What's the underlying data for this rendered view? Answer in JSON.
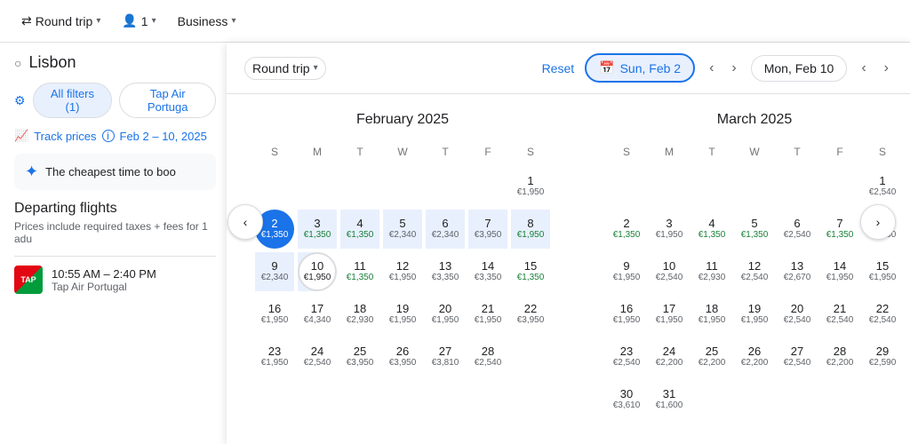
{
  "topbar": {
    "trip_type": "Round trip",
    "passengers": "1",
    "cabin_class": "Business"
  },
  "left_panel": {
    "search_placeholder": "Lisbon",
    "filters_btn": "All filters (1)",
    "airline_filter": "Tap Air Portuga",
    "track_prices_label": "Track prices",
    "track_prices_date": "Feb 2 – 10, 2025",
    "cheapest_time": "The cheapest time to boo",
    "departing_title": "Departing flights",
    "departing_sub": "Prices include required taxes + fees for 1 adu",
    "flight_time": "10:55 AM – 2:40 PM",
    "flight_airline": "Tap Air Portugal"
  },
  "calendar": {
    "trip_type": "Round trip",
    "reset_label": "Reset",
    "selected_start": "Sun, Feb 2",
    "selected_end": "Mon, Feb 10",
    "february": {
      "title": "February 2025",
      "weekdays": [
        "S",
        "M",
        "T",
        "W",
        "T",
        "F",
        "S"
      ],
      "weeks": [
        [
          null,
          null,
          null,
          null,
          null,
          null,
          {
            "d": 1,
            "p": "€1,950",
            "g": false
          }
        ],
        [
          {
            "d": 2,
            "p": "€1,350",
            "g": true,
            "selected": true
          },
          {
            "d": 3,
            "p": "€1,350",
            "g": true,
            "range": true
          },
          {
            "d": 4,
            "p": "€1,350",
            "g": true,
            "range": true
          },
          {
            "d": 5,
            "p": "€2,340",
            "g": false,
            "range": true
          },
          {
            "d": 6,
            "p": "€2,340",
            "g": false,
            "range": true
          },
          {
            "d": 7,
            "p": "€3,950",
            "g": false,
            "range": true
          },
          {
            "d": 8,
            "p": "€1,950",
            "g": true,
            "range": true
          }
        ],
        [
          {
            "d": 9,
            "p": "€2,340",
            "g": false,
            "range": true
          },
          {
            "d": 10,
            "p": "€1,950",
            "g": true,
            "end": true
          },
          {
            "d": 11,
            "p": "€1,350",
            "g": true
          },
          {
            "d": 12,
            "p": "€1,950",
            "g": false
          },
          {
            "d": 13,
            "p": "€3,350",
            "g": false
          },
          {
            "d": 14,
            "p": "€3,350",
            "g": false
          },
          {
            "d": 15,
            "p": "€1,350",
            "g": true
          }
        ],
        [
          {
            "d": 16,
            "p": "€1,950",
            "g": false
          },
          {
            "d": 17,
            "p": "€4,340",
            "g": false
          },
          {
            "d": 18,
            "p": "€2,930",
            "g": false
          },
          {
            "d": 19,
            "p": "€1,950",
            "g": false
          },
          {
            "d": 20,
            "p": "€1,950",
            "g": false
          },
          {
            "d": 21,
            "p": "€1,950",
            "g": false
          },
          {
            "d": 22,
            "p": "€3,950",
            "g": false
          }
        ],
        [
          {
            "d": 23,
            "p": "€1,950",
            "g": false
          },
          {
            "d": 24,
            "p": "€2,540",
            "g": false
          },
          {
            "d": 25,
            "p": "€3,950",
            "g": false
          },
          {
            "d": 26,
            "p": "€3,950",
            "g": false
          },
          {
            "d": 27,
            "p": "€3,810",
            "g": false
          },
          {
            "d": 28,
            "p": "€2,540",
            "g": false
          },
          null
        ]
      ]
    },
    "march": {
      "title": "March 2025",
      "weekdays": [
        "S",
        "M",
        "T",
        "W",
        "T",
        "F",
        "S"
      ],
      "weeks": [
        [
          null,
          null,
          null,
          null,
          null,
          null,
          {
            "d": 1,
            "p": "€2,540",
            "g": false
          }
        ],
        [
          {
            "d": 2,
            "p": "€1,350",
            "g": true
          },
          {
            "d": 3,
            "p": "€1,950",
            "g": false
          },
          {
            "d": 4,
            "p": "€1,350",
            "g": true
          },
          {
            "d": 5,
            "p": "€1,350",
            "g": true
          },
          {
            "d": 6,
            "p": "€2,540",
            "g": false
          },
          {
            "d": 7,
            "p": "€1,350",
            "g": true
          },
          {
            "d": 8,
            "p": "€1,950",
            "g": false
          }
        ],
        [
          {
            "d": 9,
            "p": "€1,950",
            "g": false
          },
          {
            "d": 10,
            "p": "€2,540",
            "g": false
          },
          {
            "d": 11,
            "p": "€2,930",
            "g": false
          },
          {
            "d": 12,
            "p": "€2,540",
            "g": false
          },
          {
            "d": 13,
            "p": "€2,670",
            "g": false
          },
          {
            "d": 14,
            "p": "€1,950",
            "g": false
          },
          {
            "d": 15,
            "p": "€1,950",
            "g": false
          }
        ],
        [
          {
            "d": 16,
            "p": "€1,950",
            "g": false
          },
          {
            "d": 17,
            "p": "€1,950",
            "g": false
          },
          {
            "d": 18,
            "p": "€1,950",
            "g": false
          },
          {
            "d": 19,
            "p": "€1,950",
            "g": false
          },
          {
            "d": 20,
            "p": "€2,540",
            "g": false
          },
          {
            "d": 21,
            "p": "€2,540",
            "g": false
          },
          {
            "d": 22,
            "p": "€2,540",
            "g": false
          }
        ],
        [
          {
            "d": 23,
            "p": "€2,540",
            "g": false
          },
          {
            "d": 24,
            "p": "€2,200",
            "g": false
          },
          {
            "d": 25,
            "p": "€2,200",
            "g": false
          },
          {
            "d": 26,
            "p": "€2,200",
            "g": false
          },
          {
            "d": 27,
            "p": "€2,540",
            "g": false
          },
          {
            "d": 28,
            "p": "€2,200",
            "g": false
          },
          {
            "d": 29,
            "p": "€2,590",
            "g": false
          }
        ],
        [
          {
            "d": 30,
            "p": "€3,610",
            "g": false
          },
          {
            "d": 31,
            "p": "€1,600",
            "g": false
          },
          null,
          null,
          null,
          null,
          null
        ]
      ]
    }
  }
}
